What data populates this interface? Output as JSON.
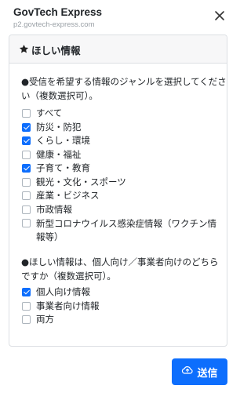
{
  "header": {
    "title": "GovTech Express",
    "url": "p2.govtech-express.com"
  },
  "card": {
    "title": "ほしい情報"
  },
  "q1": {
    "text": "●受信を希望する情報のジャンルを選択してください（複数選択可）。",
    "options": [
      {
        "label": "すべて",
        "checked": false
      },
      {
        "label": "防災・防犯",
        "checked": true
      },
      {
        "label": "くらし・環境",
        "checked": true
      },
      {
        "label": "健康・福祉",
        "checked": false
      },
      {
        "label": "子育て・教育",
        "checked": true
      },
      {
        "label": "観光・文化・スポーツ",
        "checked": false
      },
      {
        "label": "産業・ビジネス",
        "checked": false
      },
      {
        "label": "市政情報",
        "checked": false
      },
      {
        "label": "新型コロナウイルス感染症情報（ワクチン情報等）",
        "checked": false
      }
    ]
  },
  "q2": {
    "text": "●ほしい情報は、個人向け／事業者向けのどちらですか（複数選択可）。",
    "options": [
      {
        "label": "個人向け情報",
        "checked": true
      },
      {
        "label": "事業者向け情報",
        "checked": false
      },
      {
        "label": "両方",
        "checked": false
      }
    ]
  },
  "submit": {
    "label": "送信"
  },
  "colors": {
    "accent": "#0d6efd",
    "card_border": "#dcdfe3",
    "card_header_bg": "#f7f7f8"
  },
  "icons": {
    "close": "close-icon",
    "star": "star-icon",
    "upload": "cloud-upload-icon"
  }
}
